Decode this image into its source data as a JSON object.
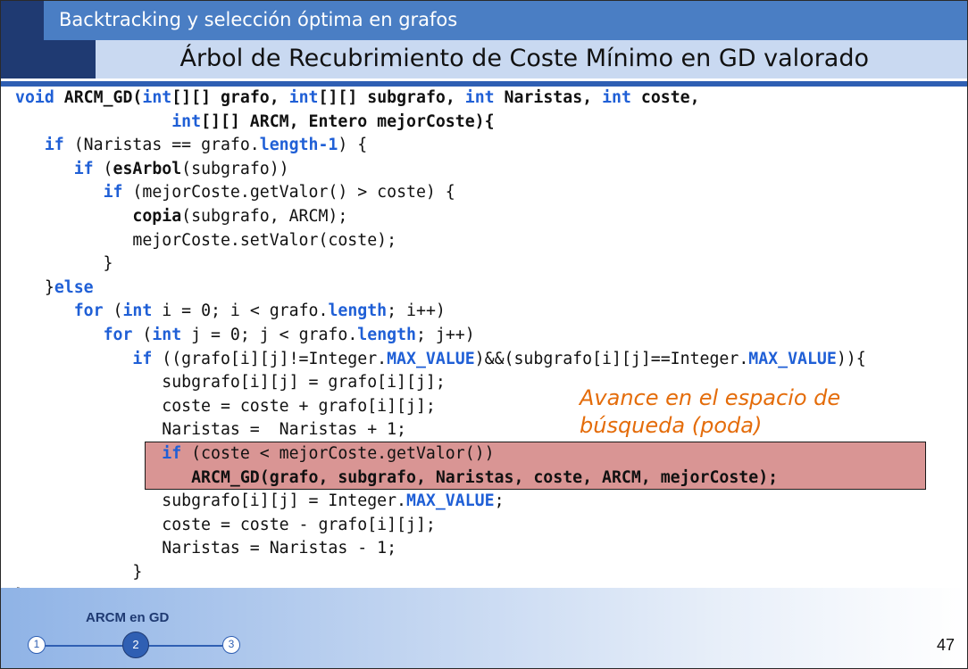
{
  "header": {
    "title": "Backtracking y selección óptima en grafos",
    "subtitle": "Árbol de Recubrimiento de Coste Mínimo en GD valorado"
  },
  "code": {
    "lines": [
      [
        {
          "t": "void",
          "s": "k"
        },
        {
          "t": " "
        },
        {
          "t": "ARCM_GD(",
          "s": "b"
        },
        {
          "t": "int",
          "s": "k"
        },
        {
          "t": "[][] grafo, ",
          "s": "b"
        },
        {
          "t": "int",
          "s": "k"
        },
        {
          "t": "[][] subgrafo, ",
          "s": "b"
        },
        {
          "t": "int",
          "s": "k"
        },
        {
          "t": " Naristas, ",
          "s": "b"
        },
        {
          "t": "int",
          "s": "k"
        },
        {
          "t": " coste,",
          "s": "b"
        }
      ],
      [
        {
          "t": "                "
        },
        {
          "t": "int",
          "s": "k"
        },
        {
          "t": "[][] ARCM, Entero mejorCoste){",
          "s": "b"
        }
      ],
      [
        {
          "t": "   "
        },
        {
          "t": "if",
          "s": "k"
        },
        {
          "t": " (Naristas == grafo."
        },
        {
          "t": "length-1",
          "s": "k"
        },
        {
          "t": ") {"
        }
      ],
      [
        {
          "t": "      "
        },
        {
          "t": "if",
          "s": "k"
        },
        {
          "t": " ("
        },
        {
          "t": "esArbol",
          "s": "b"
        },
        {
          "t": "(subgrafo))"
        }
      ],
      [
        {
          "t": "         "
        },
        {
          "t": "if",
          "s": "k"
        },
        {
          "t": " (mejorCoste.getValor() > coste) {"
        }
      ],
      [
        {
          "t": "            "
        },
        {
          "t": "copia",
          "s": "b"
        },
        {
          "t": "(subgrafo, ARCM);"
        }
      ],
      [
        {
          "t": "            mejorCoste.setValor(coste);"
        }
      ],
      [
        {
          "t": "         }"
        }
      ],
      [
        {
          "t": "   }"
        },
        {
          "t": "else",
          "s": "k"
        }
      ],
      [
        {
          "t": "      "
        },
        {
          "t": "for",
          "s": "k"
        },
        {
          "t": " ("
        },
        {
          "t": "int",
          "s": "k"
        },
        {
          "t": " i = 0; i < grafo."
        },
        {
          "t": "length",
          "s": "k"
        },
        {
          "t": "; i++)"
        }
      ],
      [
        {
          "t": "         "
        },
        {
          "t": "for",
          "s": "k"
        },
        {
          "t": " ("
        },
        {
          "t": "int",
          "s": "k"
        },
        {
          "t": " j = 0; j < grafo."
        },
        {
          "t": "length",
          "s": "k"
        },
        {
          "t": "; j++)"
        }
      ],
      [
        {
          "t": "            "
        },
        {
          "t": "if",
          "s": "k"
        },
        {
          "t": " ((grafo[i][j]!=Integer."
        },
        {
          "t": "MAX_VALUE",
          "s": "k"
        },
        {
          "t": ")&&(subgrafo[i][j]==Integer."
        },
        {
          "t": "MAX_VALUE",
          "s": "k"
        },
        {
          "t": ")){"
        }
      ],
      [
        {
          "t": "               subgrafo[i][j] = grafo[i][j];"
        }
      ],
      [
        {
          "t": "               coste = coste + grafo[i][j];"
        }
      ],
      [
        {
          "t": "               Naristas =  Naristas + 1;"
        }
      ],
      [
        {
          "t": "               "
        },
        {
          "t": "if",
          "s": "k"
        },
        {
          "t": " (coste < mejorCoste.getValor())"
        }
      ],
      [
        {
          "t": "                  "
        },
        {
          "t": "ARCM_GD(grafo, subgrafo, Naristas, coste, ARCM, mejorCoste);",
          "s": "b"
        }
      ],
      [
        {
          "t": "               subgrafo[i][j] = Integer."
        },
        {
          "t": "MAX_VALUE",
          "s": "k"
        },
        {
          "t": ";"
        }
      ],
      [
        {
          "t": "               coste = coste - grafo[i][j];"
        }
      ],
      [
        {
          "t": "               Naristas = Naristas - 1;"
        }
      ],
      [
        {
          "t": "            }"
        }
      ],
      [
        {
          "t": "}"
        }
      ]
    ]
  },
  "annotation": {
    "line1": "Avance en el espacio de",
    "line2": "búsqueda (poda)"
  },
  "footer": {
    "section_label": "ARCM en GD",
    "steps": [
      "1",
      "2",
      "3"
    ],
    "active_step": "2",
    "page_number": "47"
  }
}
